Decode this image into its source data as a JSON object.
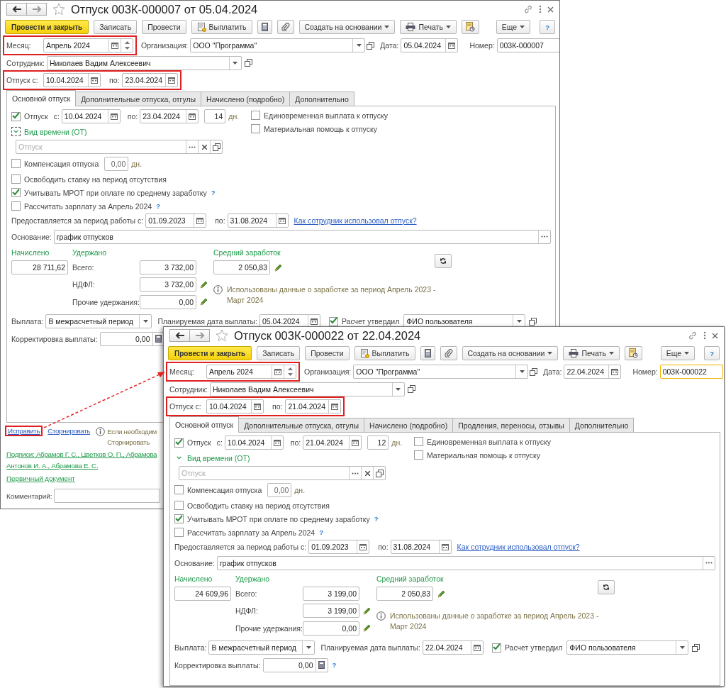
{
  "windows": [
    {
      "title": "Отпуск 003К-000007 от 05.04.2024",
      "toolbar": [
        {
          "kind": "primary",
          "label": "Провести и закрыть"
        },
        {
          "kind": "plain",
          "label": "Записать"
        },
        {
          "kind": "plain",
          "label": "Провести"
        },
        {
          "kind": "pay",
          "label": "Выплатить"
        },
        {
          "kind": "calc"
        },
        {
          "kind": "clip"
        },
        {
          "kind": "menu",
          "label": "Создать на основании"
        },
        {
          "kind": "print",
          "label": "Печать"
        },
        {
          "kind": "report"
        },
        {
          "kind": "more",
          "label": "Еще"
        },
        {
          "kind": "help",
          "label": "?"
        }
      ],
      "month": {
        "label": "Месяц:",
        "value": "Апрель 2024",
        "highlighted": true
      },
      "organization": {
        "label": "Организация:",
        "value": "ООО \"Программа\""
      },
      "date": {
        "label": "Дата:",
        "value": "05.04.2024"
      },
      "number": {
        "label": "Номер:",
        "value": "003К-000007",
        "focused": false
      },
      "employee": {
        "label": "Сотрудник:",
        "value": "Николаев Вадим Алексеевич"
      },
      "vacation_period": {
        "label": "Отпуск с:",
        "from": "10.04.2024",
        "to_label": "по:",
        "to": "23.04.2024",
        "highlighted": true
      },
      "tabs": [
        {
          "label": "Основной отпуск",
          "selected": true
        },
        {
          "label": "Дополнительные отпуска, отгулы",
          "selected": false
        },
        {
          "label": "Начислено (подробно)",
          "selected": false
        },
        {
          "label": "Дополнительно",
          "selected": false
        }
      ],
      "vacation": {
        "label": "Отпуск",
        "checked": true,
        "from_label": "с:",
        "from": "10.04.2024",
        "to_label": "по:",
        "to": "23.04.2024",
        "days": "14",
        "unit": "дн."
      },
      "extra_checks": [
        {
          "label": "Единовременная выплата к отпуску",
          "checked": false
        },
        {
          "label": "Материальная помощь к отпуску",
          "checked": false
        }
      ],
      "time_kind": {
        "label": "Вид времени (ОТ)",
        "expanded": true,
        "focused": true,
        "placeholder": "Отпуск"
      },
      "compensation": {
        "label": "Компенсация отпуска",
        "checked": false,
        "value": "0,00",
        "unit": "дн."
      },
      "options": [
        {
          "label": "Освободить ставку на период отсутствия",
          "checked": false
        },
        {
          "label": "Учитывать МРОТ при оплате по среднему заработку",
          "checked": true,
          "help": "?"
        },
        {
          "label": "Рассчитать зарплату за Апрель 2024",
          "checked": false,
          "help": "?"
        }
      ],
      "work_period": {
        "label": "Предоставляется за период работы с:",
        "from": "01.09.2023",
        "to_label": "по:",
        "to": "31.08.2024",
        "link": "Как сотрудник использовал отпуск?"
      },
      "basis": {
        "label": "Основание:",
        "value": "график отпусков"
      },
      "accrued": {
        "title": "Начислено",
        "value": "28 711,62"
      },
      "withheld": {
        "title": "Удержано",
        "rows": [
          {
            "label": "Всего:",
            "value": "3 732,00",
            "editable": false
          },
          {
            "label": "НДФЛ:",
            "value": "3 732,00",
            "editable": true
          },
          {
            "label": "Прочие удержания:",
            "value": "0,00",
            "editable": true
          }
        ]
      },
      "average": {
        "title": "Средний заработок",
        "value": "2 050,83"
      },
      "info": "Использованы данные о заработке за период Апрель 2023 - Март 2024",
      "payment": {
        "label": "Выплата:",
        "value": "В межрасчетный период",
        "date_label": "Планируемая дата выплаты:",
        "date": "05.04.2024",
        "approved_label": "Расчет утвердил",
        "approved": true,
        "approver": "ФИО пользователя"
      },
      "correction": {
        "label": "Корректировка выплаты:",
        "value": "0,00"
      },
      "footer": {
        "actions": [
          {
            "label": "Исправить",
            "highlighted": true
          },
          {
            "label": "Сторнировать",
            "highlighted": false
          }
        ],
        "info": [
          "Если необходим",
          "Сторнировать"
        ],
        "signatures": [
          "Подписи: Абрамов Г. С., Цветков О. П., Абрамова",
          "Антонов И. А., Абрамова Е. С."
        ],
        "primary_document": "Первичный документ",
        "comment_label": "Комментарий:"
      }
    },
    {
      "title": "Отпуск 003К-000022 от 22.04.2024",
      "toolbar": [
        {
          "kind": "primary",
          "label": "Провести и закрыть"
        },
        {
          "kind": "plain",
          "label": "Записать"
        },
        {
          "kind": "plain",
          "label": "Провести"
        },
        {
          "kind": "pay",
          "label": "Выплатить"
        },
        {
          "kind": "calc"
        },
        {
          "kind": "clip"
        },
        {
          "kind": "menu",
          "label": "Создать на основании"
        },
        {
          "kind": "print",
          "label": "Печать"
        },
        {
          "kind": "report"
        },
        {
          "kind": "more",
          "label": "Еще"
        },
        {
          "kind": "help",
          "label": "?"
        }
      ],
      "month": {
        "label": "Месяц:",
        "value": "Апрель 2024",
        "highlighted": true
      },
      "organization": {
        "label": "Организация:",
        "value": "ООО \"Программа\""
      },
      "date": {
        "label": "Дата:",
        "value": "22.04.2024"
      },
      "number": {
        "label": "Номер:",
        "value": "003К-000022",
        "focused": true
      },
      "employee": {
        "label": "Сотрудник:",
        "value": "Николаев Вадим Алексеевич"
      },
      "vacation_period": {
        "label": "Отпуск с:",
        "from": "10.04.2024",
        "to_label": "по:",
        "to": "21.04.2024",
        "highlighted": true
      },
      "tabs": [
        {
          "label": "Основной отпуск",
          "selected": true
        },
        {
          "label": "Дополнительные отпуска, отгулы",
          "selected": false
        },
        {
          "label": "Начислено (подробно)",
          "selected": false
        },
        {
          "label": "Продления, переносы, отзывы",
          "selected": false
        },
        {
          "label": "Дополнительно",
          "selected": false
        }
      ],
      "vacation": {
        "label": "Отпуск",
        "checked": true,
        "from_label": "с:",
        "from": "10.04.2024",
        "to_label": "по:",
        "to": "21.04.2024",
        "days": "12",
        "unit": "дн."
      },
      "extra_checks": [
        {
          "label": "Единовременная выплата к отпуску",
          "checked": false
        },
        {
          "label": "Материальная помощь к отпуску",
          "checked": false
        }
      ],
      "time_kind": {
        "label": "Вид времени (ОТ)",
        "expanded": true,
        "focused": false,
        "placeholder": "Отпуск"
      },
      "compensation": {
        "label": "Компенсация отпуска",
        "checked": false,
        "value": "0,00",
        "unit": "дн."
      },
      "options": [
        {
          "label": "Освободить ставку на период отсутствия",
          "checked": false
        },
        {
          "label": "Учитывать МРОТ при оплате по среднему заработку",
          "checked": true,
          "help": "?"
        },
        {
          "label": "Рассчитать зарплату за Апрель 2024",
          "checked": false,
          "help": "?"
        }
      ],
      "work_period": {
        "label": "Предоставляется за период работы с:",
        "from": "01.09.2023",
        "to_label": "по:",
        "to": "31.08.2024",
        "link": "Как сотрудник использовал отпуск?"
      },
      "basis": {
        "label": "Основание:",
        "value": "график отпусков"
      },
      "accrued": {
        "title": "Начислено",
        "value": "24 609,96"
      },
      "withheld": {
        "title": "Удержано",
        "rows": [
          {
            "label": "Всего:",
            "value": "3 199,00",
            "editable": false
          },
          {
            "label": "НДФЛ:",
            "value": "3 199,00",
            "editable": true
          },
          {
            "label": "Прочие удержания:",
            "value": "0,00",
            "editable": true
          }
        ]
      },
      "average": {
        "title": "Средний заработок",
        "value": "2 050,83"
      },
      "info": "Использованы данные о заработке за период Апрель 2023 - Март 2024",
      "payment": {
        "label": "Выплата:",
        "value": "В межрасчетный период",
        "date_label": "Планируемая дата выплаты:",
        "date": "22.04.2024",
        "approved_label": "Расчет утвердил",
        "approved": true,
        "approver": "ФИО пользователя"
      },
      "correction": {
        "label": "Корректировка выплаты:",
        "value": "0,00",
        "help": "?"
      }
    }
  ]
}
